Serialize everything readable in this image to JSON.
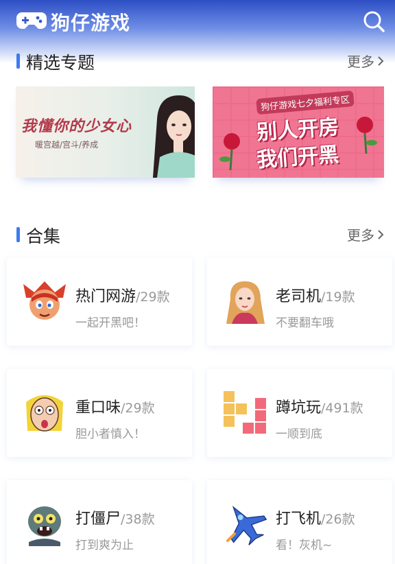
{
  "header": {
    "title": "狗仔游戏",
    "logo_icon": "gamepad-icon",
    "search_icon": "search-icon"
  },
  "featured": {
    "title": "精选专题",
    "more_label": "更多",
    "banners": [
      {
        "headline": "我懂你的少女心",
        "subline": "暖宫越/宫斗/养成",
        "theme_color": "#b33a4a"
      },
      {
        "tag": "狗仔游戏七夕福利专区",
        "line1": "别人开房",
        "line2": "我们开黑",
        "theme_color": "#f07592"
      }
    ]
  },
  "collections": {
    "title": "合集",
    "more_label": "更多",
    "items": [
      {
        "name": "热门网游",
        "count": "/29款",
        "desc": "一起开黑吧！",
        "icon": "warrior-icon"
      },
      {
        "name": "老司机",
        "count": "/19款",
        "desc": "不要翻车哦",
        "icon": "blonde-girl-icon"
      },
      {
        "name": "重口味",
        "count": "/29款",
        "desc": "胆小者慎入！",
        "icon": "scared-face-icon"
      },
      {
        "name": "蹲坑玩",
        "count": "/491款",
        "desc": "一顺到底",
        "icon": "blocks-icon"
      },
      {
        "name": "打僵尸",
        "count": "/38款",
        "desc": "打到爽为止",
        "icon": "zombie-icon"
      },
      {
        "name": "打飞机",
        "count": "/26款",
        "desc": "看！灰机~",
        "icon": "jet-icon"
      }
    ]
  },
  "colors": {
    "accent": "#3d7bf0",
    "header_top": "#2d4fc4"
  }
}
